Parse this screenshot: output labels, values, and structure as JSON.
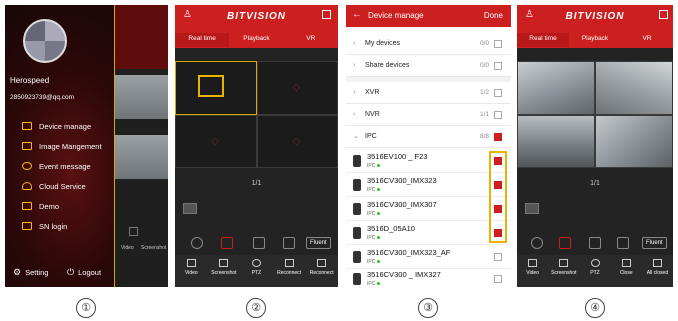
{
  "captions": [
    "①",
    "②",
    "③",
    "④"
  ],
  "menu": {
    "username": "Herospeed",
    "email": "2850923739@qq.com",
    "items": [
      "Device manage",
      "Image Mangement",
      "Event message",
      "Cloud Service",
      "Demo",
      "SN login"
    ],
    "setting": "Setting",
    "logout": "Logout"
  },
  "app": {
    "brand": "BITVISION",
    "tabs": [
      "Real time",
      "Playback",
      "VR"
    ],
    "pager": "1/1",
    "fluent": "Fluent",
    "toolbar2": [
      "Video",
      "Screenshot",
      "PTZ",
      "Reconnect",
      "Reconnect"
    ],
    "toolbar4": [
      "Video",
      "Screenshot",
      "PTZ",
      "Close",
      "All closed"
    ],
    "peek_toolbar": [
      "Video",
      "Screenshot"
    ]
  },
  "manage": {
    "title": "Device manage",
    "done": "Done",
    "groups": [
      {
        "label": "My devices",
        "count": "0/0",
        "checked": false,
        "open": false
      },
      {
        "label": "Share devices",
        "count": "0/0",
        "checked": false,
        "open": false
      },
      {
        "label": "XVR",
        "count": "1/2",
        "checked": false,
        "open": false
      },
      {
        "label": "NVR",
        "count": "1/1",
        "checked": false,
        "open": false
      },
      {
        "label": "IPC",
        "count": "8/8",
        "checked": true,
        "open": true
      }
    ],
    "type_label": "IPC",
    "devices": [
      {
        "name": "3516EV100 _ F23",
        "checked": true
      },
      {
        "name": "3516CV300_IMX323",
        "checked": true
      },
      {
        "name": "3516CV300_IMX307",
        "checked": true
      },
      {
        "name": "3516D_05A10",
        "checked": true
      },
      {
        "name": "3516CV300_IMX323_AF",
        "checked": false
      },
      {
        "name": "3516CV300 _ IMX327",
        "checked": false
      }
    ]
  }
}
